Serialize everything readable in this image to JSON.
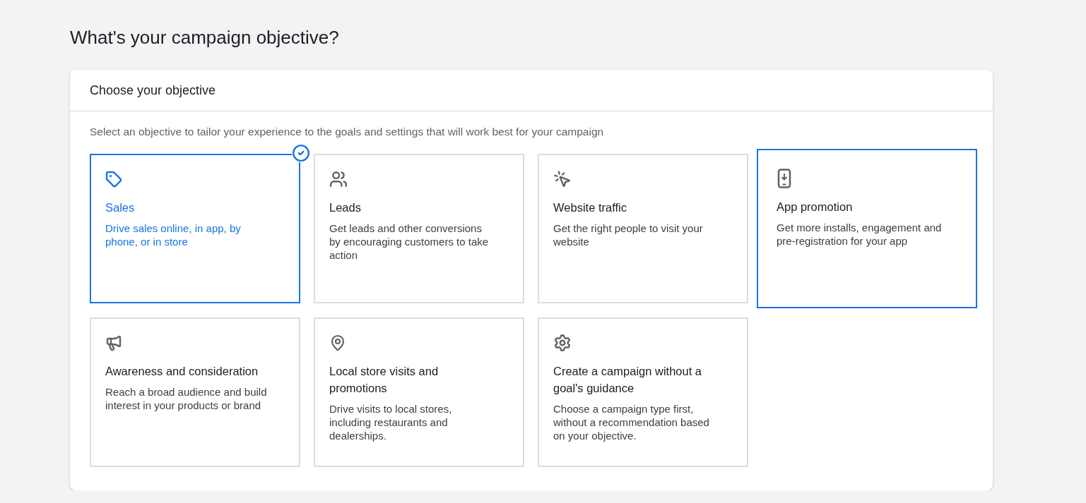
{
  "page": {
    "title": "What's your campaign objective?"
  },
  "panel": {
    "title": "Choose your objective",
    "description": "Select an objective to tailor your experience to the goals and settings that will work best for your campaign"
  },
  "objectives": [
    {
      "kind": "sales",
      "title": "Sales",
      "description": "Drive sales online, in app, by phone, or in store",
      "selected": true,
      "highlighted": false
    },
    {
      "kind": "leads",
      "title": "Leads",
      "description": "Get leads and other conversions by encouraging customers to take action",
      "selected": false,
      "highlighted": false
    },
    {
      "kind": "traffic",
      "title": "Website traffic",
      "description": "Get the right people to visit your website",
      "selected": false,
      "highlighted": false
    },
    {
      "kind": "app",
      "title": "App promotion",
      "description": "Get more installs, engagement and pre-registration for your app",
      "selected": false,
      "highlighted": true
    },
    {
      "kind": "awareness",
      "title": "Awareness and consideration",
      "description": "Reach a broad audience and build interest in your products or brand",
      "selected": false,
      "highlighted": false
    },
    {
      "kind": "local",
      "title": "Local store visits and promotions",
      "description": "Drive visits to local stores, including restaurants and dealerships.",
      "selected": false,
      "highlighted": false
    },
    {
      "kind": "none",
      "title": "Create a campaign without a goal's guidance",
      "description": "Choose a campaign type first, without a recommendation based on your objective.",
      "selected": false,
      "highlighted": false
    }
  ]
}
